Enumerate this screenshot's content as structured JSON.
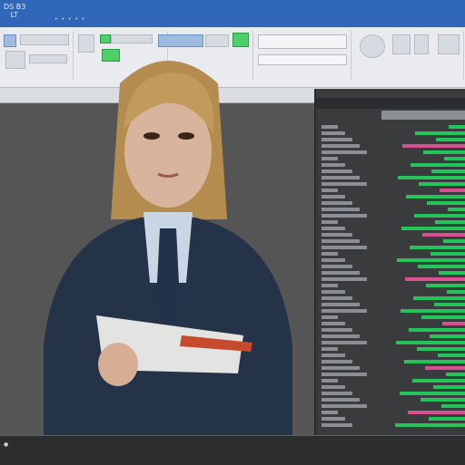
{
  "titlebar": {
    "text": "DS B3\n   LT"
  },
  "colors": {
    "titlebar": "#2f66b8",
    "accent_green": "#23c45a",
    "accent_pink": "#d8508f"
  },
  "figure": {
    "subject": "woman in navy suit holding folder"
  }
}
